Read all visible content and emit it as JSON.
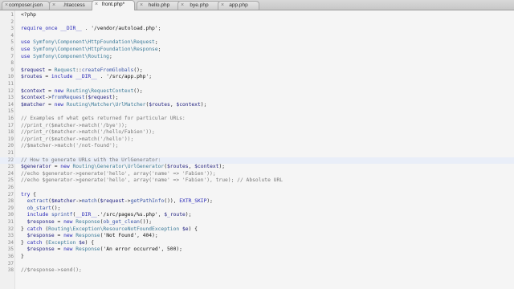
{
  "tabs": [
    {
      "label": "composer.json",
      "active": false
    },
    {
      "label": ".htaccess",
      "active": false
    },
    {
      "label": "front.php*",
      "active": true
    },
    {
      "label": "hello.php",
      "active": false
    },
    {
      "label": "bye.php",
      "active": false
    },
    {
      "label": "app.php",
      "active": false
    }
  ],
  "current_line": 22,
  "lines": [
    [
      [
        "tag",
        "<?php"
      ]
    ],
    [],
    [
      [
        "kw",
        "require_once"
      ],
      [
        "op",
        " "
      ],
      [
        "const",
        "__DIR__"
      ],
      [
        "op",
        " . "
      ],
      [
        "str",
        "'/vendor/autoload.php'"
      ],
      [
        "op",
        ";"
      ]
    ],
    [],
    [
      [
        "kw",
        "use"
      ],
      [
        "op",
        " "
      ],
      [
        "ns",
        "Symfony\\Component\\HttpFoundation\\Request"
      ],
      [
        "op",
        ";"
      ]
    ],
    [
      [
        "kw",
        "use"
      ],
      [
        "op",
        " "
      ],
      [
        "ns",
        "Symfony\\Component\\HttpFoundation\\Response"
      ],
      [
        "op",
        ";"
      ]
    ],
    [
      [
        "kw",
        "use"
      ],
      [
        "op",
        " "
      ],
      [
        "ns",
        "Symfony\\Component\\Routing"
      ],
      [
        "op",
        ";"
      ]
    ],
    [],
    [
      [
        "var",
        "$request"
      ],
      [
        "op",
        " = "
      ],
      [
        "cls",
        "Request"
      ],
      [
        "op",
        "::"
      ],
      [
        "fn",
        "createFromGlobals"
      ],
      [
        "op",
        "();"
      ]
    ],
    [
      [
        "var",
        "$routes"
      ],
      [
        "op",
        " = "
      ],
      [
        "kw",
        "include"
      ],
      [
        "op",
        " "
      ],
      [
        "const",
        "__DIR__"
      ],
      [
        "op",
        " . "
      ],
      [
        "str",
        "'/src/app.php'"
      ],
      [
        "op",
        ";"
      ]
    ],
    [],
    [
      [
        "var",
        "$context"
      ],
      [
        "op",
        " = "
      ],
      [
        "kw",
        "new"
      ],
      [
        "op",
        " "
      ],
      [
        "ns",
        "Routing\\RequestContext"
      ],
      [
        "op",
        "();"
      ]
    ],
    [
      [
        "var",
        "$context"
      ],
      [
        "op",
        "->"
      ],
      [
        "fn",
        "fromRequest"
      ],
      [
        "op",
        "("
      ],
      [
        "var",
        "$request"
      ],
      [
        "op",
        ");"
      ]
    ],
    [
      [
        "var",
        "$matcher"
      ],
      [
        "op",
        " = "
      ],
      [
        "kw",
        "new"
      ],
      [
        "op",
        " "
      ],
      [
        "ns",
        "Routing\\Matcher\\UrlMatcher"
      ],
      [
        "op",
        "("
      ],
      [
        "var",
        "$routes"
      ],
      [
        "op",
        ", "
      ],
      [
        "var",
        "$context"
      ],
      [
        "op",
        ");"
      ]
    ],
    [],
    [
      [
        "com",
        "// Examples of what gets returned for particular URLs:"
      ]
    ],
    [
      [
        "com",
        "//print_r($matcher->match('/bye'));"
      ]
    ],
    [
      [
        "com",
        "//print_r($matcher->match('/hello/Fabien'));"
      ]
    ],
    [
      [
        "com",
        "//print_r($matcher->match('/hello'));"
      ]
    ],
    [
      [
        "com",
        "//$matcher->match('/not-found');"
      ]
    ],
    [],
    [
      [
        "com",
        "// How to generate URLs with the UrlGenerator:"
      ]
    ],
    [
      [
        "var",
        "$generator"
      ],
      [
        "op",
        " = "
      ],
      [
        "kw",
        "new"
      ],
      [
        "op",
        " "
      ],
      [
        "ns",
        "Routing\\Generator\\UrlGenerator"
      ],
      [
        "op",
        "("
      ],
      [
        "var",
        "$routes"
      ],
      [
        "op",
        ", "
      ],
      [
        "var",
        "$context"
      ],
      [
        "op",
        ");"
      ]
    ],
    [
      [
        "com",
        "//echo $generator->generate('hello', array('name' => 'Fabien'));"
      ]
    ],
    [
      [
        "com",
        "//echo $generator->generate('hello', array('name' => 'Fabien'), true); // Absolute URL"
      ]
    ],
    [],
    [
      [
        "kw",
        "try"
      ],
      [
        "op",
        " {"
      ]
    ],
    [
      [
        "op",
        "  "
      ],
      [
        "fn",
        "extract"
      ],
      [
        "op",
        "("
      ],
      [
        "var",
        "$matcher"
      ],
      [
        "op",
        "->"
      ],
      [
        "fn",
        "match"
      ],
      [
        "op",
        "("
      ],
      [
        "var",
        "$request"
      ],
      [
        "op",
        "->"
      ],
      [
        "fn",
        "getPathInfo"
      ],
      [
        "op",
        "()), "
      ],
      [
        "const",
        "EXTR_SKIP"
      ],
      [
        "op",
        ");"
      ]
    ],
    [
      [
        "op",
        "  "
      ],
      [
        "fn",
        "ob_start"
      ],
      [
        "op",
        "();"
      ]
    ],
    [
      [
        "op",
        "  "
      ],
      [
        "kw",
        "include"
      ],
      [
        "op",
        " "
      ],
      [
        "fn",
        "sprintf"
      ],
      [
        "op",
        "("
      ],
      [
        "const",
        "__DIR__"
      ],
      [
        "op",
        "."
      ],
      [
        "str",
        "'/src/pages/%s.php'"
      ],
      [
        "op",
        ", "
      ],
      [
        "var",
        "$_route"
      ],
      [
        "op",
        ");"
      ]
    ],
    [
      [
        "op",
        "  "
      ],
      [
        "var",
        "$response"
      ],
      [
        "op",
        " = "
      ],
      [
        "kw",
        "new"
      ],
      [
        "op",
        " "
      ],
      [
        "cls",
        "Response"
      ],
      [
        "op",
        "("
      ],
      [
        "fn",
        "ob_get_clean"
      ],
      [
        "op",
        "());"
      ]
    ],
    [
      [
        "op",
        "} "
      ],
      [
        "kw",
        "catch"
      ],
      [
        "op",
        " ("
      ],
      [
        "ns",
        "Routing\\Exception\\ResourceNotFoundException"
      ],
      [
        "op",
        " "
      ],
      [
        "var",
        "$e"
      ],
      [
        "op",
        ") {"
      ]
    ],
    [
      [
        "op",
        "  "
      ],
      [
        "var",
        "$response"
      ],
      [
        "op",
        " = "
      ],
      [
        "kw",
        "new"
      ],
      [
        "op",
        " "
      ],
      [
        "cls",
        "Response"
      ],
      [
        "op",
        "("
      ],
      [
        "str",
        "'Not Found'"
      ],
      [
        "op",
        ", 404);"
      ]
    ],
    [
      [
        "op",
        "} "
      ],
      [
        "kw",
        "catch"
      ],
      [
        "op",
        " ("
      ],
      [
        "cls",
        "Exception"
      ],
      [
        "op",
        " "
      ],
      [
        "var",
        "$e"
      ],
      [
        "op",
        ") {"
      ]
    ],
    [
      [
        "op",
        "  "
      ],
      [
        "var",
        "$response"
      ],
      [
        "op",
        " = "
      ],
      [
        "kw",
        "new"
      ],
      [
        "op",
        " "
      ],
      [
        "cls",
        "Response"
      ],
      [
        "op",
        "("
      ],
      [
        "str",
        "'An error occurred'"
      ],
      [
        "op",
        ", 500);"
      ]
    ],
    [
      [
        "op",
        "}"
      ]
    ],
    [],
    [
      [
        "com",
        "//$response->send();"
      ]
    ]
  ]
}
